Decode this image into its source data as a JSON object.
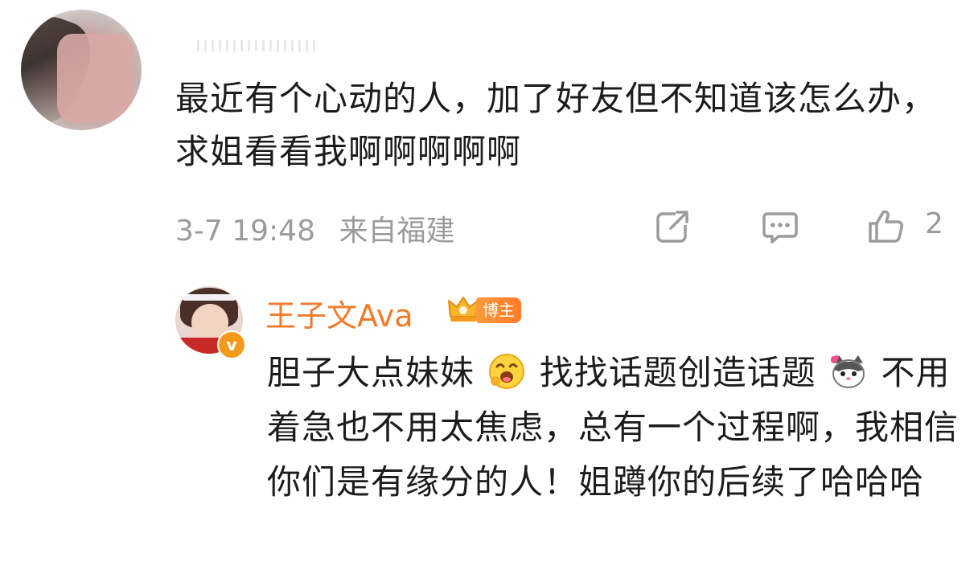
{
  "comment": {
    "text": "最近有个心动的人，加了好友但不知道该怎么办，求姐看看我啊啊啊啊啊",
    "time": "3-7 19:48",
    "location": "来自福建",
    "like_count": "2",
    "icons": {
      "share": "share-icon",
      "comment": "comment-icon",
      "like": "thumbs-up-icon"
    }
  },
  "reply": {
    "author": "王子文Ava",
    "badge_label": "博主",
    "verified_mark": "v",
    "text_part1": "胆子大点妹妹",
    "text_part2": "找找话题创造话题",
    "text_part3": "不用着急也不用太焦虑，总有一个过程啊，我相信你们是有缘分的人！姐蹲你的后续了哈哈哈",
    "emojis": [
      "laughing-face-emoji",
      "cat-emoji"
    ]
  },
  "colors": {
    "author_orange": "#ef7b2b",
    "meta_gray": "#9b9b9b",
    "text": "#1c1c1c",
    "badge_orange": "#ff8a30"
  }
}
